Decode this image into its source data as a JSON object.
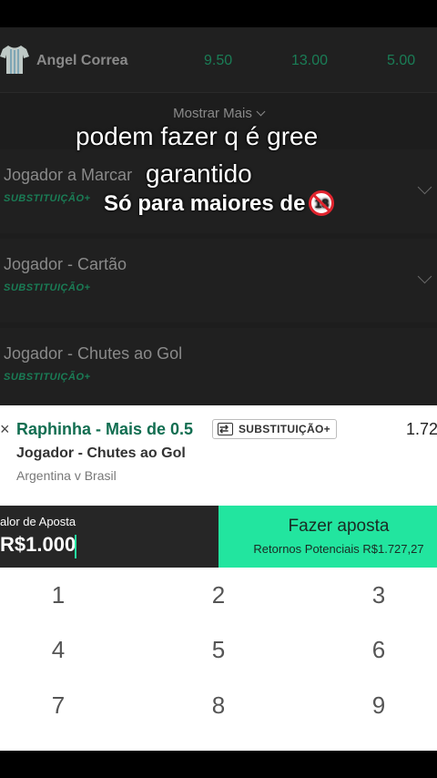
{
  "player_row": {
    "name": "Angel Correa",
    "odds": [
      "9.50",
      "13.00",
      "5.00"
    ]
  },
  "show_more": "Mostrar Mais",
  "markets": [
    {
      "title": "Jogador a Marcar",
      "tag": "SUBSTITUIÇÃO+"
    },
    {
      "title": "Jogador - Cartão",
      "tag": "SUBSTITUIÇÃO+"
    },
    {
      "title": "Jogador - Chutes ao Gol",
      "tag": "SUBSTITUIÇÃO+"
    }
  ],
  "overlay": {
    "line1": "podem fazer q é gree",
    "line2": "garantido",
    "line3": "Só para maiores de",
    "age": "18"
  },
  "bet_slip": {
    "close": "×",
    "selection": "Raphinha - Mais de 0.5",
    "badge": "SUBSTITUIÇÃO+",
    "price": "1.72",
    "market": "Jogador - Chutes ao Gol",
    "match": "Argentina v Brasil"
  },
  "stake": {
    "label": "alor de Aposta",
    "value": "R$1.000"
  },
  "place_bet": {
    "label": "Fazer aposta",
    "returns": "Retornos Potenciais R$1.727,27"
  },
  "keypad": [
    "1",
    "2",
    "3",
    "4",
    "5",
    "6",
    "7",
    "8",
    "9"
  ],
  "colors": {
    "accent": "#22e59f",
    "selection_green": "#126e51",
    "odds_green": "#1a7d56"
  }
}
